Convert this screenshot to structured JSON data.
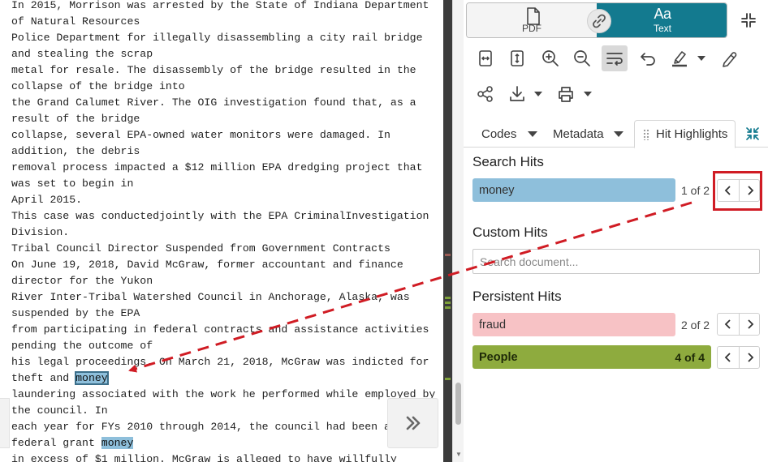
{
  "document": {
    "lines": [
      {
        "text": "In 2015, Morrison was arrested by the State of Indiana Department"
      },
      {
        "text": "of Natural Resources"
      },
      {
        "text": "Police Department for illegally disassembling a city rail bridge"
      },
      {
        "text": "and stealing the scrap"
      },
      {
        "text": "metal for resale. The disassembly of the bridge resulted in the"
      },
      {
        "text": "collapse of the bridge into"
      },
      {
        "text": "the Grand Calumet River. The OIG investigation found that, as a"
      },
      {
        "text": "result of the bridge"
      },
      {
        "text": "collapse, several EPA-owned water monitors were damaged. In"
      },
      {
        "text": "addition, the debris"
      },
      {
        "text": "removal process impacted a $12 million EPA dredging project that"
      },
      {
        "text": "was set to begin in"
      },
      {
        "text": "April 2015."
      },
      {
        "text": "This case was conductedjointly with the EPA CriminalInvestigation"
      },
      {
        "text": "Division."
      },
      {
        "text": "Tribal Council Director Suspended from Government Contracts"
      },
      {
        "text": "On June 19, 2018, David McGraw, former accountant and finance"
      },
      {
        "text": "director for the Yukon"
      },
      {
        "text": "River Inter-Tribal Watershed Council in Anchorage, Alaska, was"
      },
      {
        "text": "suspended by the EPA"
      },
      {
        "text": "from participating in federal contracts and assistance activities"
      },
      {
        "text": "pending the outcome of"
      },
      {
        "text": "his legal proceedings. On March 21, 2018, McGraw was indicted for"
      },
      {
        "text": "theft and ",
        "hit": "money",
        "current": true
      },
      {
        "text": "laundering associated with the work he performed while employed by"
      },
      {
        "text": "the council. In"
      },
      {
        "text": "each year for FYs 2010 through 2014, the council had been awarded"
      },
      {
        "text": "federal grant ",
        "hit": "money"
      },
      {
        "text": "in excess of $1 million. McGraw is alleged to have willfully"
      }
    ]
  },
  "view_toggle": {
    "pdf_label": "PDF",
    "text_label": "Text",
    "text_glyph": "Aa"
  },
  "toolbar": {
    "icons": [
      "fit-width-icon",
      "fit-height-icon",
      "zoom-in-icon",
      "zoom-out-icon",
      "wrap-text-icon",
      "undo-icon",
      "highlighter-icon",
      "pen-icon",
      "share-icon",
      "download-icon",
      "print-icon"
    ]
  },
  "tabs": {
    "codes": "Codes",
    "metadata": "Metadata",
    "hit_highlights": "Hit Highlights"
  },
  "search_hits": {
    "title": "Search Hits",
    "items": [
      {
        "term": "money",
        "count": "1 of 2",
        "color": "#8ebfdb"
      }
    ]
  },
  "custom_hits": {
    "title": "Custom Hits",
    "placeholder": "Search document..."
  },
  "persistent_hits": {
    "title": "Persistent Hits",
    "items": [
      {
        "term": "fraud",
        "count": "2 of 2",
        "color": "#f7c2c5"
      },
      {
        "term": "People",
        "count": "4 of 4",
        "color": "#8eab3e"
      }
    ]
  },
  "colors": {
    "accent": "#137a8f",
    "annotation": "#d01c24"
  }
}
